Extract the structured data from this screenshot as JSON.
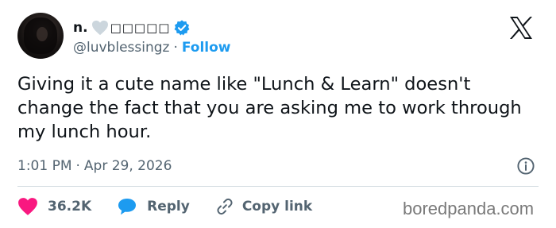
{
  "author": {
    "display_name": "n.",
    "name_decorations": "□□□□□",
    "handle": "@luvblessingz",
    "separator": "·",
    "follow_label": "Follow"
  },
  "tweet": {
    "text": "Giving it a cute name like \"Lunch & Learn\" doesn't change the fact that you are asking me to work through my lunch hour."
  },
  "meta": {
    "time": "1:01 PM",
    "separator": "·",
    "date": "Apr 29, 2026"
  },
  "actions": {
    "like_count": "36.2K",
    "reply_label": "Reply",
    "copy_label": "Copy link"
  },
  "watermark": "boredpanda.com",
  "icons": {
    "avatar": "avatar",
    "heart_emoji": "white-heart-icon",
    "verified": "verified-badge-icon",
    "brand": "x-logo-icon",
    "info": "info-icon",
    "like": "heart-icon",
    "reply": "speech-bubble-icon",
    "copy": "link-icon"
  },
  "colors": {
    "text": "#0f1419",
    "secondary": "#536471",
    "accent": "#1d9bf0",
    "like": "#f91880",
    "divider": "#cfd9de"
  }
}
